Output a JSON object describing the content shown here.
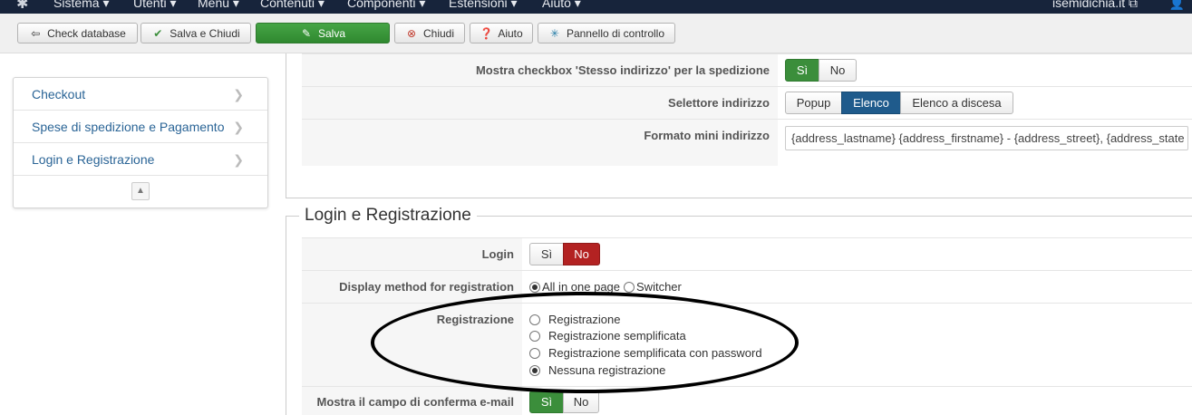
{
  "topnav": {
    "menu": [
      "Sistema ▾",
      "Utenti ▾",
      "Menu ▾",
      "Contenuti ▾",
      "Componenti ▾",
      "Estensioni ▾",
      "Aiuto ▾"
    ],
    "site": "isemidichia.it ⧉"
  },
  "toolbar": {
    "check_database": "Check database",
    "save_close": "Salva e Chiudi",
    "save": "Salva",
    "close": "Chiudi",
    "help": "Aiuto",
    "control_panel": "Pannello di controllo"
  },
  "sidebar": {
    "items": [
      {
        "label": "Checkout"
      },
      {
        "label": "Spese di spedizione e Pagamento"
      },
      {
        "label": "Login e Registrazione"
      }
    ]
  },
  "address_section": {
    "same_address": {
      "label": "Mostra checkbox 'Stesso indirizzo' per la spedizione",
      "options": [
        "Sì",
        "No"
      ],
      "selected": "Sì"
    },
    "address_selector": {
      "label": "Selettore indirizzo",
      "options": [
        "Popup",
        "Elenco",
        "Elenco a discesa"
      ],
      "selected": "Elenco"
    },
    "mini_format": {
      "label": "Formato mini indirizzo",
      "value": "{address_lastname} {address_firstname} - {address_street}, {address_state"
    }
  },
  "login_section": {
    "legend": "Login e Registrazione",
    "login": {
      "label": "Login",
      "options": [
        "Sì",
        "No"
      ],
      "selected": "No"
    },
    "display_method": {
      "label": "Display method for registration",
      "options": [
        "All in one page",
        "Switcher"
      ],
      "selected": "All in one page"
    },
    "registration": {
      "label": "Registrazione",
      "options": [
        "Registrazione",
        "Registrazione semplificata",
        "Registrazione semplificata con password",
        "Nessuna registrazione"
      ],
      "selected": "Nessuna registrazione"
    },
    "email_confirm": {
      "label": "Mostra il campo di conferma e-mail",
      "options": [
        "Sì",
        "No"
      ],
      "selected": "Sì"
    }
  },
  "colors": {
    "nav_bg": "#17243b",
    "green": "#3b8e3b",
    "red": "#b32222",
    "blue": "#1f5b8c",
    "link": "#2a6496"
  }
}
